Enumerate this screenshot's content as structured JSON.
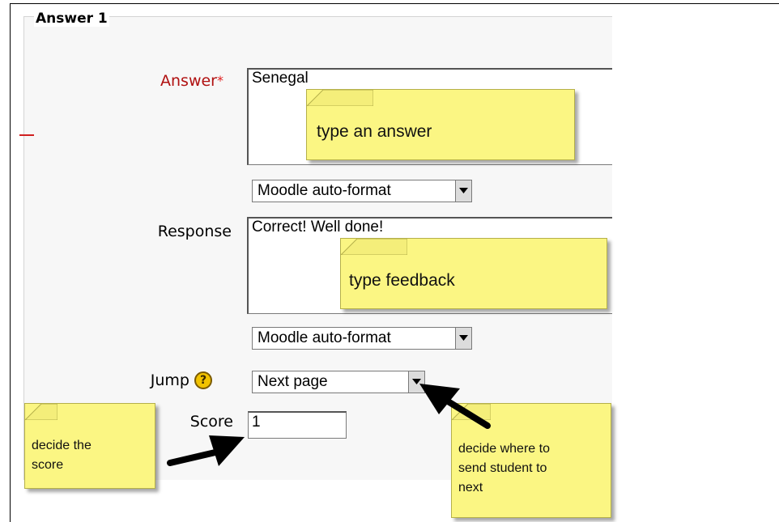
{
  "fieldset": {
    "legend": "Answer 1"
  },
  "answer": {
    "label": "Answer",
    "required_mark": "*",
    "value": "Senegal",
    "format": "Moodle auto-format"
  },
  "response": {
    "label": "Response",
    "value": "Correct! Well done!",
    "format": "Moodle auto-format"
  },
  "jump": {
    "label": "Jump",
    "help_glyph": "?",
    "value": "Next page"
  },
  "score": {
    "label": "Score",
    "value": "1"
  },
  "notes": {
    "answer": "type an answer",
    "feedback": "type feedback",
    "score_line1": "decide the",
    "score_line2": "score",
    "jump_line1": "decide where to",
    "jump_line2": "send student to",
    "jump_line3": "next"
  },
  "colors": {
    "required": "#b01010",
    "note_fill": "#fbf683",
    "help_icon": "#f2c300"
  }
}
